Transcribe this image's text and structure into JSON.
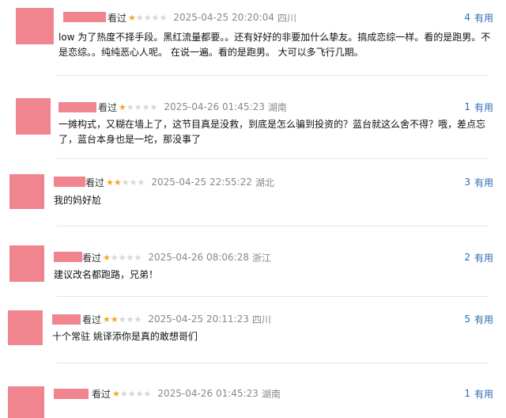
{
  "comments": [
    {
      "watched": "看过",
      "rating": 1,
      "time": "2025-04-25 20:20:04",
      "location": "四川",
      "votes": "4",
      "useful_label": "有用",
      "content": "low 为了热度不择手段。黑红流量都要。。还有好好的非要加什么挚友。搞成恋综一样。看的是跑男。不是恋综。。纯纯恶心人呢。 在说一遍。看的是跑男。 大可以多飞行几期。"
    },
    {
      "watched": "看过",
      "rating": 1,
      "time": "2025-04-26 01:45:23",
      "location": "湖南",
      "votes": "1",
      "useful_label": "有用",
      "content": "一摊构式，又糊在墙上了，这节目真是没救，到底是怎么骗到投资的？蓝台就这么舍不得？哦，差点忘了，蓝台本身也是一坨，那没事了"
    },
    {
      "watched": "看过",
      "rating": 2,
      "time": "2025-04-25 22:55:22",
      "location": "湖北",
      "votes": "3",
      "useful_label": "有用",
      "content": "我的妈好尬"
    },
    {
      "watched": "看过",
      "rating": 1,
      "time": "2025-04-26 08:06:28",
      "location": "浙江",
      "votes": "2",
      "useful_label": "有用",
      "content": "建议改名都跑路，兄弟！"
    },
    {
      "watched": "看过",
      "rating": 2,
      "time": "2025-04-25 20:11:23",
      "location": "四川",
      "votes": "5",
      "useful_label": "有用",
      "content": "十个常驻 姚译添你是真的敢想哥们"
    },
    {
      "watched": "看过",
      "rating": 1,
      "time": "2025-04-26 01:45:23",
      "location": "湖南",
      "votes": "1",
      "useful_label": "有用",
      "content": ""
    }
  ],
  "colors": {
    "mask": "#f0848f",
    "star_on": "#f5a623",
    "link": "#2b6cb3"
  }
}
